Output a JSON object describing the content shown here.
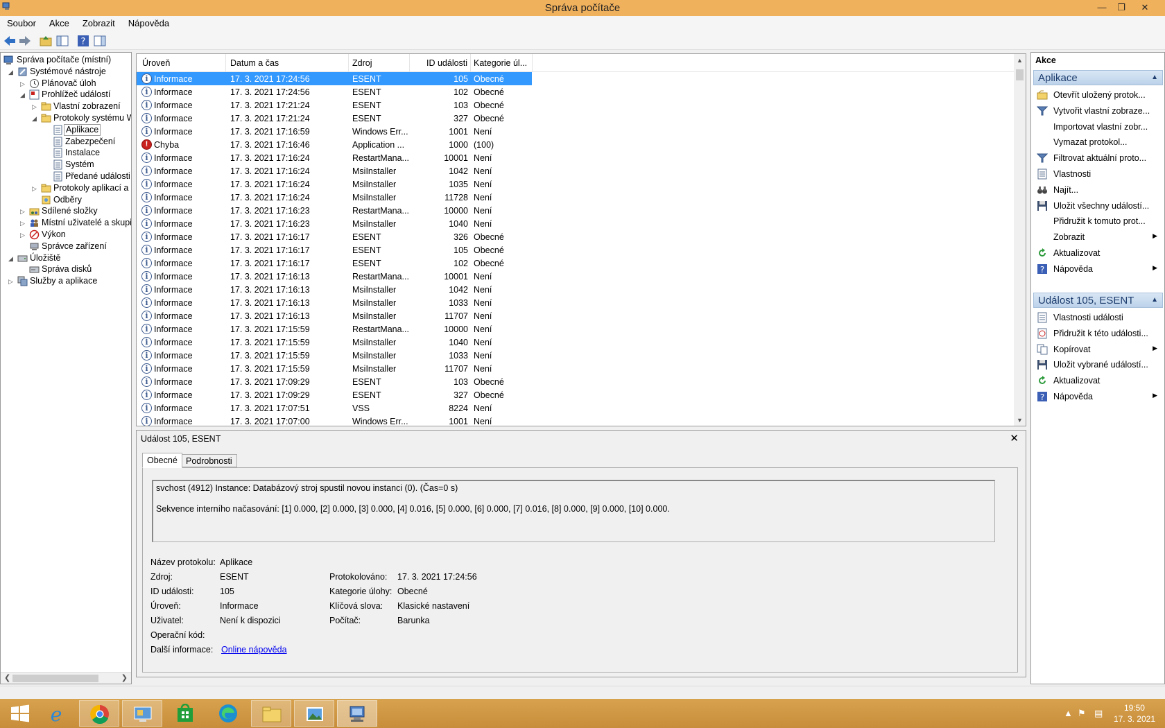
{
  "window": {
    "title": "Správa počítače",
    "minimize": "—",
    "restore": "❐",
    "close": "✕"
  },
  "menu": [
    "Soubor",
    "Akce",
    "Zobrazit",
    "Nápověda"
  ],
  "tree": [
    {
      "label": "Správa počítače (místní)",
      "level": 0,
      "exp": "",
      "icon": "computer-management-icon"
    },
    {
      "label": "Systémové nástroje",
      "level": 1,
      "exp": "◢",
      "icon": "system-tools-icon"
    },
    {
      "label": "Plánovač úloh",
      "level": 2,
      "exp": "▷",
      "icon": "clock-icon"
    },
    {
      "label": "Prohlížeč událostí",
      "level": 2,
      "exp": "◢",
      "icon": "event-viewer-icon"
    },
    {
      "label": "Vlastní zobrazení",
      "level": 3,
      "exp": "▷",
      "icon": "folder-icon"
    },
    {
      "label": "Protokoly systému W",
      "level": 3,
      "exp": "◢",
      "icon": "folder-icon"
    },
    {
      "label": "Aplikace",
      "level": 4,
      "exp": "",
      "icon": "log-icon",
      "selected": true
    },
    {
      "label": "Zabezpečení",
      "level": 4,
      "exp": "",
      "icon": "log-icon"
    },
    {
      "label": "Instalace",
      "level": 4,
      "exp": "",
      "icon": "log-icon"
    },
    {
      "label": "Systém",
      "level": 4,
      "exp": "",
      "icon": "log-icon"
    },
    {
      "label": "Předané události",
      "level": 4,
      "exp": "",
      "icon": "log-icon"
    },
    {
      "label": "Protokoly aplikací a",
      "level": 3,
      "exp": "▷",
      "icon": "folder-icon"
    },
    {
      "label": "Odběry",
      "level": 3,
      "exp": "",
      "icon": "subscription-icon"
    },
    {
      "label": "Sdílené složky",
      "level": 2,
      "exp": "▷",
      "icon": "shared-folder-icon"
    },
    {
      "label": "Místní uživatelé a skupir",
      "level": 2,
      "exp": "▷",
      "icon": "users-icon"
    },
    {
      "label": "Výkon",
      "level": 2,
      "exp": "▷",
      "icon": "performance-icon"
    },
    {
      "label": "Správce zařízení",
      "level": 2,
      "exp": "",
      "icon": "device-manager-icon"
    },
    {
      "label": "Úložiště",
      "level": 1,
      "exp": "◢",
      "icon": "storage-icon"
    },
    {
      "label": "Správa disků",
      "level": 2,
      "exp": "",
      "icon": "disk-icon"
    },
    {
      "label": "Služby a aplikace",
      "level": 1,
      "exp": "▷",
      "icon": "services-icon"
    }
  ],
  "list": {
    "columns": [
      "Úroveň",
      "Datum a čas",
      "Zdroj",
      "ID události",
      "Kategorie úl..."
    ],
    "rows": [
      {
        "level": "Informace",
        "date": "17. 3. 2021 17:24:56",
        "source": "ESENT",
        "id": "105",
        "cat": "Obecné",
        "type": "info"
      },
      {
        "level": "Informace",
        "date": "17. 3. 2021 17:24:56",
        "source": "ESENT",
        "id": "102",
        "cat": "Obecné",
        "type": "info"
      },
      {
        "level": "Informace",
        "date": "17. 3. 2021 17:21:24",
        "source": "ESENT",
        "id": "103",
        "cat": "Obecné",
        "type": "info"
      },
      {
        "level": "Informace",
        "date": "17. 3. 2021 17:21:24",
        "source": "ESENT",
        "id": "327",
        "cat": "Obecné",
        "type": "info"
      },
      {
        "level": "Informace",
        "date": "17. 3. 2021 17:16:59",
        "source": "Windows Err...",
        "id": "1001",
        "cat": "Není",
        "type": "info"
      },
      {
        "level": "Chyba",
        "date": "17. 3. 2021 17:16:46",
        "source": "Application ...",
        "id": "1000",
        "cat": "(100)",
        "type": "error"
      },
      {
        "level": "Informace",
        "date": "17. 3. 2021 17:16:24",
        "source": "RestartMana...",
        "id": "10001",
        "cat": "Není",
        "type": "info"
      },
      {
        "level": "Informace",
        "date": "17. 3. 2021 17:16:24",
        "source": "MsiInstaller",
        "id": "1042",
        "cat": "Není",
        "type": "info"
      },
      {
        "level": "Informace",
        "date": "17. 3. 2021 17:16:24",
        "source": "MsiInstaller",
        "id": "1035",
        "cat": "Není",
        "type": "info"
      },
      {
        "level": "Informace",
        "date": "17. 3. 2021 17:16:24",
        "source": "MsiInstaller",
        "id": "11728",
        "cat": "Není",
        "type": "info"
      },
      {
        "level": "Informace",
        "date": "17. 3. 2021 17:16:23",
        "source": "RestartMana...",
        "id": "10000",
        "cat": "Není",
        "type": "info"
      },
      {
        "level": "Informace",
        "date": "17. 3. 2021 17:16:23",
        "source": "MsiInstaller",
        "id": "1040",
        "cat": "Není",
        "type": "info"
      },
      {
        "level": "Informace",
        "date": "17. 3. 2021 17:16:17",
        "source": "ESENT",
        "id": "326",
        "cat": "Obecné",
        "type": "info"
      },
      {
        "level": "Informace",
        "date": "17. 3. 2021 17:16:17",
        "source": "ESENT",
        "id": "105",
        "cat": "Obecné",
        "type": "info"
      },
      {
        "level": "Informace",
        "date": "17. 3. 2021 17:16:17",
        "source": "ESENT",
        "id": "102",
        "cat": "Obecné",
        "type": "info"
      },
      {
        "level": "Informace",
        "date": "17. 3. 2021 17:16:13",
        "source": "RestartMana...",
        "id": "10001",
        "cat": "Není",
        "type": "info"
      },
      {
        "level": "Informace",
        "date": "17. 3. 2021 17:16:13",
        "source": "MsiInstaller",
        "id": "1042",
        "cat": "Není",
        "type": "info"
      },
      {
        "level": "Informace",
        "date": "17. 3. 2021 17:16:13",
        "source": "MsiInstaller",
        "id": "1033",
        "cat": "Není",
        "type": "info"
      },
      {
        "level": "Informace",
        "date": "17. 3. 2021 17:16:13",
        "source": "MsiInstaller",
        "id": "11707",
        "cat": "Není",
        "type": "info"
      },
      {
        "level": "Informace",
        "date": "17. 3. 2021 17:15:59",
        "source": "RestartMana...",
        "id": "10000",
        "cat": "Není",
        "type": "info"
      },
      {
        "level": "Informace",
        "date": "17. 3. 2021 17:15:59",
        "source": "MsiInstaller",
        "id": "1040",
        "cat": "Není",
        "type": "info"
      },
      {
        "level": "Informace",
        "date": "17. 3. 2021 17:15:59",
        "source": "MsiInstaller",
        "id": "1033",
        "cat": "Není",
        "type": "info"
      },
      {
        "level": "Informace",
        "date": "17. 3. 2021 17:15:59",
        "source": "MsiInstaller",
        "id": "11707",
        "cat": "Není",
        "type": "info"
      },
      {
        "level": "Informace",
        "date": "17. 3. 2021 17:09:29",
        "source": "ESENT",
        "id": "103",
        "cat": "Obecné",
        "type": "info"
      },
      {
        "level": "Informace",
        "date": "17. 3. 2021 17:09:29",
        "source": "ESENT",
        "id": "327",
        "cat": "Obecné",
        "type": "info"
      },
      {
        "level": "Informace",
        "date": "17. 3. 2021 17:07:51",
        "source": "VSS",
        "id": "8224",
        "cat": "Není",
        "type": "info"
      },
      {
        "level": "Informace",
        "date": "17. 3. 2021 17:07:00",
        "source": "Windows Err...",
        "id": "1001",
        "cat": "Není",
        "type": "info"
      }
    ]
  },
  "detail": {
    "title": "Událost 105, ESENT",
    "close": "✕",
    "tabs": [
      "Obecné",
      "Podrobnosti"
    ],
    "message_line1": "svchost (4912) Instance: Databázový stroj spustil novou instanci (0). (Čas=0 s)",
    "message_line2": "Sekvence interního načasování: [1] 0.000, [2] 0.000, [3] 0.000, [4] 0.016, [5] 0.000, [6] 0.000, [7] 0.016, [8] 0.000, [9] 0.000, [10] 0.000.",
    "fields": {
      "log_name_label": "Název protokolu:",
      "log_name": "Aplikace",
      "source_label": "Zdroj:",
      "source": "ESENT",
      "event_id_label": "ID události:",
      "event_id": "105",
      "level_label": "Úroveň:",
      "level": "Informace",
      "user_label": "Uživatel:",
      "user": "Není k dispozici",
      "opcode_label": "Operační kód:",
      "opcode": "",
      "more_info_label": "Další informace:",
      "more_info_link": "Online nápověda",
      "logged_label": "Protokolováno:",
      "logged": "17. 3. 2021 17:24:56",
      "task_cat_label": "Kategorie úlohy:",
      "task_cat": "Obecné",
      "keywords_label": "Klíčová slova:",
      "keywords": "Klasické nastavení",
      "computer_label": "Počítač:",
      "computer": "Barunka"
    }
  },
  "actions": {
    "title": "Akce",
    "section1": "Aplikace",
    "items1": [
      {
        "label": "Otevřít uložený protok...",
        "icon": "open-folder-icon",
        "sub": false
      },
      {
        "label": "Vytvořit vlastní zobraze...",
        "icon": "filter-icon",
        "sub": false
      },
      {
        "label": "Importovat vlastní zobr...",
        "icon": "",
        "sub": false
      },
      {
        "label": "Vymazat protokol...",
        "icon": "",
        "sub": false
      },
      {
        "label": "Filtrovat aktuální proto...",
        "icon": "filter-icon",
        "sub": false
      },
      {
        "label": "Vlastnosti",
        "icon": "properties-icon",
        "sub": false
      },
      {
        "label": "Najít...",
        "icon": "binoculars-icon",
        "sub": false
      },
      {
        "label": "Uložit všechny událostí...",
        "icon": "save-icon",
        "sub": false
      },
      {
        "label": "Přidružit k tomuto prot...",
        "icon": "",
        "sub": false
      },
      {
        "label": "Zobrazit",
        "icon": "",
        "sub": true
      },
      {
        "label": "Aktualizovat",
        "icon": "refresh-icon",
        "sub": false
      },
      {
        "label": "Nápověda",
        "icon": "help-icon",
        "sub": true
      }
    ],
    "section2": "Událost 105, ESENT",
    "items2": [
      {
        "label": "Vlastnosti události",
        "icon": "properties-icon",
        "sub": false
      },
      {
        "label": "Přidružit k této události...",
        "icon": "task-icon",
        "sub": false
      },
      {
        "label": "Kopírovat",
        "icon": "copy-icon",
        "sub": true
      },
      {
        "label": "Uložit vybrané událostí...",
        "icon": "save-icon",
        "sub": false
      },
      {
        "label": "Aktualizovat",
        "icon": "refresh-icon",
        "sub": false
      },
      {
        "label": "Nápověda",
        "icon": "help-icon",
        "sub": true
      }
    ]
  },
  "taskbar": {
    "time": "19:50",
    "date": "17. 3. 2021",
    "apps": [
      "start-icon",
      "internet-explorer-icon",
      "chrome-icon",
      "control-panel-icon",
      "store-icon",
      "edge-icon",
      "file-explorer-icon",
      "photos-icon",
      "computer-management-icon"
    ]
  },
  "colors": {
    "titlebar": "#f0b15d",
    "selection": "#3399ff",
    "taskbar": "#c88d3a",
    "link": "#0000ee"
  }
}
